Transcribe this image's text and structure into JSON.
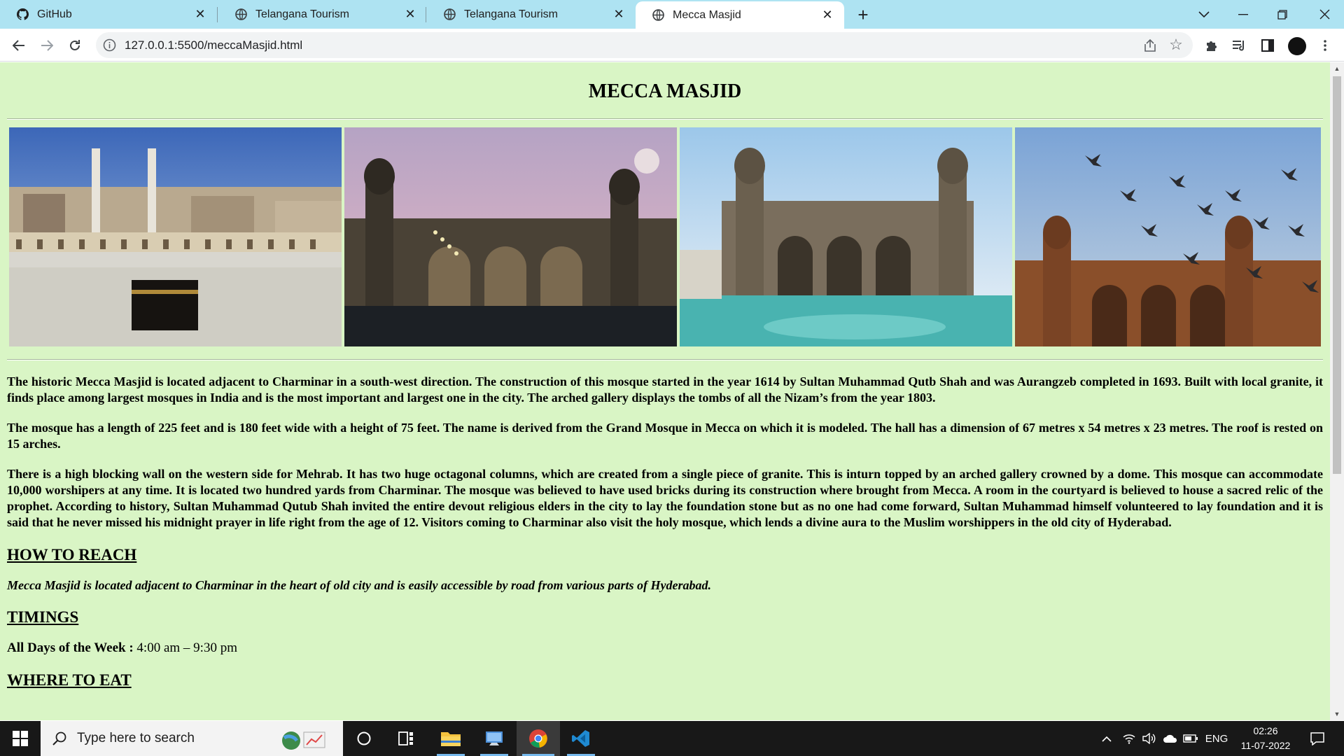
{
  "browser": {
    "tabs": [
      {
        "title": "GitHub",
        "icon": "github-icon",
        "active": false
      },
      {
        "title": "Telangana Tourism",
        "icon": "globe-icon",
        "active": false
      },
      {
        "title": "Telangana Tourism",
        "icon": "globe-icon",
        "active": false
      },
      {
        "title": "Mecca Masjid",
        "icon": "globe-icon",
        "active": true
      }
    ],
    "url": "127.0.0.1:5500/meccaMasjid.html"
  },
  "page": {
    "background": "#d9f5c5",
    "title": "MECCA MASJID",
    "gallery": [
      {
        "subject": "Kaaba courtyard with crowds",
        "icon": "photo"
      },
      {
        "subject": "Mecca Masjid at dusk with moon",
        "icon": "photo"
      },
      {
        "subject": "Mecca Masjid with fountain pool",
        "icon": "photo"
      },
      {
        "subject": "Mecca Masjid with flying pigeons",
        "icon": "photo"
      }
    ],
    "paragraphs": [
      "The historic Mecca Masjid is located adjacent to Charminar in a south-west direction. The construction of this mosque started in the year 1614 by Sultan Muhammad Qutb Shah and was Aurangzeb completed in 1693. Built with local granite, it finds place among largest mosques in India and is the most important and largest one in the city. The arched gallery displays the tombs of all the Nizam’s from the year 1803.",
      "The mosque has a length of 225 feet and is 180 feet wide with a height of 75 feet. The name is derived from the Grand Mosque in Mecca on which it is modeled. The hall has a dimension of 67 metres x 54 metres x 23 metres. The roof is rested on 15 arches.",
      "There is a high blocking wall on the western side for Mehrab. It has two huge octagonal columns, which are created from a single piece of granite. This is inturn topped by an arched gallery crowned by a dome. This mosque can accommodate 10,000 worshipers at any time. It is located two hundred yards from Charminar. The mosque was believed to have used bricks during its construction where brought from Mecca. A room in the courtyard is believed to house a sacred relic of the prophet. According to history, Sultan Muhammad Qutub Shah invited the entire devout religious elders in the city to lay the foundation stone but as no one had come forward, Sultan Muhammad himself volunteered to lay foundation and it is said that he never missed his midnight prayer in life right from the age of 12. Visitors coming to Charminar also visit the holy mosque, which lends a divine aura to the Muslim worshippers in the old city of Hyderabad."
    ],
    "how_to_reach": {
      "heading": "HOW TO REACH",
      "text": "Mecca Masjid is located adjacent to Charminar in the heart of old city and is easily accessible by road from various parts of Hyderabad."
    },
    "timings": {
      "heading": "TIMINGS",
      "label": "All Days of the Week :",
      "value": " 4:00 am – 9:30 pm"
    },
    "where_to_eat": {
      "heading": "WHERE TO EAT"
    }
  },
  "taskbar": {
    "search_placeholder": "Type here to search",
    "language": "ENG",
    "time": "02:26",
    "date": "11-07-2022",
    "apps": [
      "task-view",
      "file-explorer",
      "desktop-app",
      "chrome",
      "vscode"
    ]
  }
}
